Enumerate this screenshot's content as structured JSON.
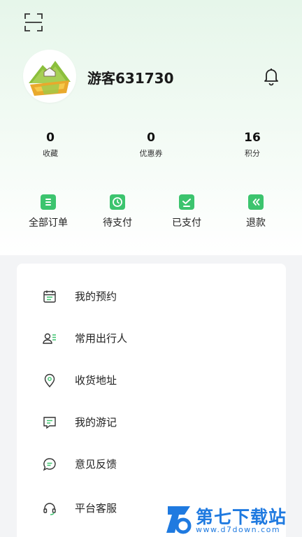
{
  "colors": {
    "accent": "#3cc46e",
    "header_gradient": "#e6f6ea",
    "watermark": "#1f7ae0"
  },
  "header": {
    "scan_icon": "scan-icon",
    "username": "游客631730",
    "bell_icon": "bell-icon"
  },
  "stats": [
    {
      "value": "0",
      "label": "收藏"
    },
    {
      "value": "0",
      "label": "优惠券"
    },
    {
      "value": "16",
      "label": "积分"
    }
  ],
  "orders": [
    {
      "label": "全部订单",
      "icon": "all-orders-icon"
    },
    {
      "label": "待支付",
      "icon": "pending-payment-icon"
    },
    {
      "label": "已支付",
      "icon": "paid-icon"
    },
    {
      "label": "退款",
      "icon": "refund-icon"
    }
  ],
  "menu": [
    {
      "label": "我的预约",
      "icon": "calendar-icon"
    },
    {
      "label": "常用出行人",
      "icon": "traveler-icon"
    },
    {
      "label": "收货地址",
      "icon": "location-pin-icon"
    },
    {
      "label": "我的游记",
      "icon": "travel-notes-icon"
    },
    {
      "label": "意见反馈",
      "icon": "feedback-icon"
    },
    {
      "label": "平台客服",
      "icon": "headset-icon"
    }
  ],
  "watermark": {
    "name": "第七下载站",
    "url": "www.d7down.com"
  }
}
